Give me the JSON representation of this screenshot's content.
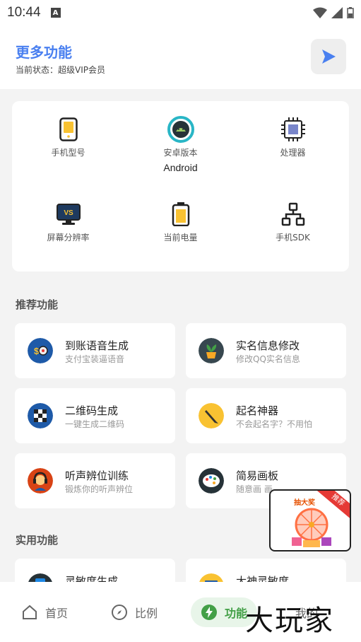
{
  "status_bar": {
    "time": "10:44",
    "notification": "A"
  },
  "header": {
    "title": "更多功能",
    "subtitle": "当前状态：超级VIP会员"
  },
  "device_info": [
    {
      "label": "手机型号",
      "value": "",
      "icon": "phone-icon"
    },
    {
      "label": "安卓版本",
      "value": "Android",
      "icon": "android-icon"
    },
    {
      "label": "处理器",
      "value": "",
      "icon": "cpu-icon"
    },
    {
      "label": "屏幕分辨率",
      "value": "",
      "icon": "monitor-icon"
    },
    {
      "label": "当前电量",
      "value": "",
      "icon": "battery-icon"
    },
    {
      "label": "手机SDK",
      "value": "",
      "icon": "sdk-icon"
    }
  ],
  "recommended": {
    "title": "推荐功能",
    "items": [
      {
        "title": "到账语音生成",
        "subtitle": "支付宝装逼语音",
        "icon": "money-speaker-icon"
      },
      {
        "title": "实名信息修改",
        "subtitle": "修改QQ实名信息",
        "icon": "plant-icon"
      },
      {
        "title": "二维码生成",
        "subtitle": "一键生成二维码",
        "icon": "qrcode-icon"
      },
      {
        "title": "起名神器",
        "subtitle": "不会起名字？不用怕",
        "icon": "pen-icon"
      },
      {
        "title": "听声辨位训练",
        "subtitle": "锻炼你的听声辨位",
        "icon": "headset-icon"
      },
      {
        "title": "简易画板",
        "subtitle": "随意画 画",
        "icon": "palette-icon"
      }
    ]
  },
  "utility": {
    "title": "实用功能",
    "items": [
      {
        "title": "灵敏度生成",
        "icon": "phone-blue-icon"
      },
      {
        "title": "大神灵敏度",
        "icon": "folder-icon"
      }
    ]
  },
  "promo": {
    "title": "抽大奖",
    "ribbon": "推荐"
  },
  "nav": [
    {
      "label": "首页",
      "icon": "home-icon"
    },
    {
      "label": "比例",
      "icon": "compass-icon"
    },
    {
      "label": "功能",
      "icon": "bolt-icon",
      "active": true
    },
    {
      "label": "我的",
      "icon": "user-icon"
    }
  ],
  "watermark": "大玩家",
  "colors": {
    "accent": "#4a80f0",
    "active_nav": "#43a047",
    "background": "#f3f3f3"
  }
}
